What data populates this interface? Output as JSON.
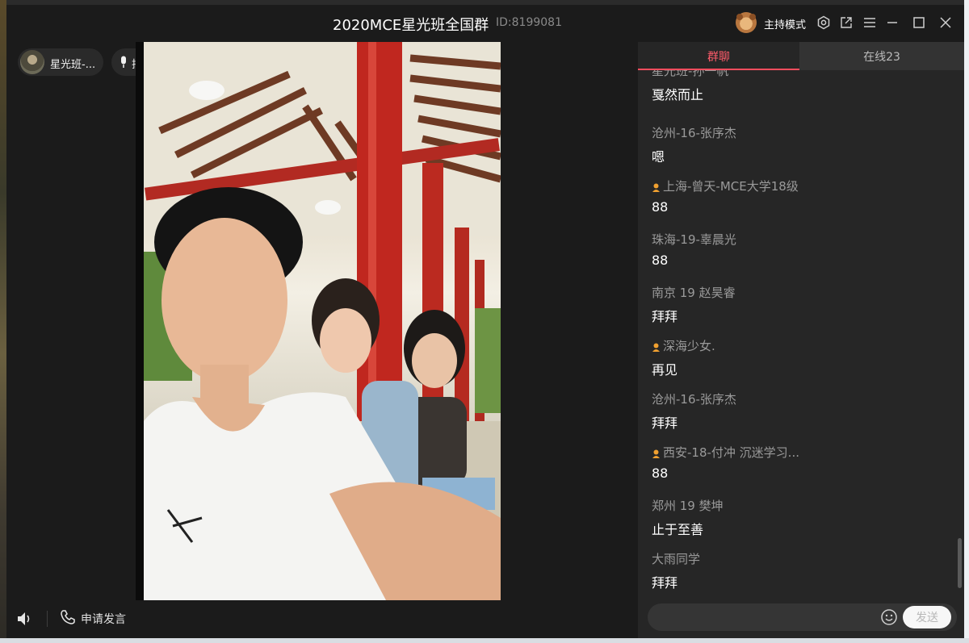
{
  "window": {
    "title": "2020MCE星光班全国群",
    "group_id": "ID:8199081",
    "host_mode_label": "主持模式"
  },
  "stage": {
    "speaker_name": "星光班-...",
    "queue_label": "排麦",
    "apply_speak_label": "申请发言"
  },
  "chat": {
    "tabs": [
      {
        "label": "群聊",
        "active": true
      },
      {
        "label": "在线23",
        "active": false
      }
    ],
    "messages": [
      {
        "name": "星光班-孙一帆",
        "text": "戛然而止",
        "badge": false
      },
      {
        "name": "沧州-16-张序杰",
        "text": "嗯",
        "badge": false
      },
      {
        "name": "上海-曾天-MCE大学18级",
        "text": "88",
        "badge": true
      },
      {
        "name": "珠海-19-辜晨光",
        "text": "88",
        "badge": false
      },
      {
        "name": "南京 19 赵昊睿",
        "text": "拜拜",
        "badge": false
      },
      {
        "name": "深海少女.",
        "text": "再见",
        "badge": true
      },
      {
        "name": "沧州-16-张序杰",
        "text": "拜拜",
        "badge": false
      },
      {
        "name": "西安-18-付冲  沉迷学习...",
        "text": "88",
        "badge": true
      },
      {
        "name": "郑州 19 樊坤",
        "text": "止于至善",
        "badge": false
      },
      {
        "name": "大雨同学",
        "text": "拜拜",
        "badge": false
      }
    ],
    "send_label": "发送"
  },
  "icons": {
    "settings": "gear-icon",
    "popout": "external-window-icon",
    "menu": "hamburger-menu-icon",
    "minimize": "minimize-icon",
    "maximize": "maximize-icon",
    "close": "close-icon",
    "volume": "speaker-icon",
    "phone": "phone-icon",
    "emoji": "emoji-icon",
    "mic": "microphone-icon",
    "badge": "crown-icon"
  },
  "colors": {
    "accent": "#ff4d5e",
    "window_bg": "#1b1b1b",
    "chat_bg": "#262626",
    "badge": "#f0a030"
  }
}
